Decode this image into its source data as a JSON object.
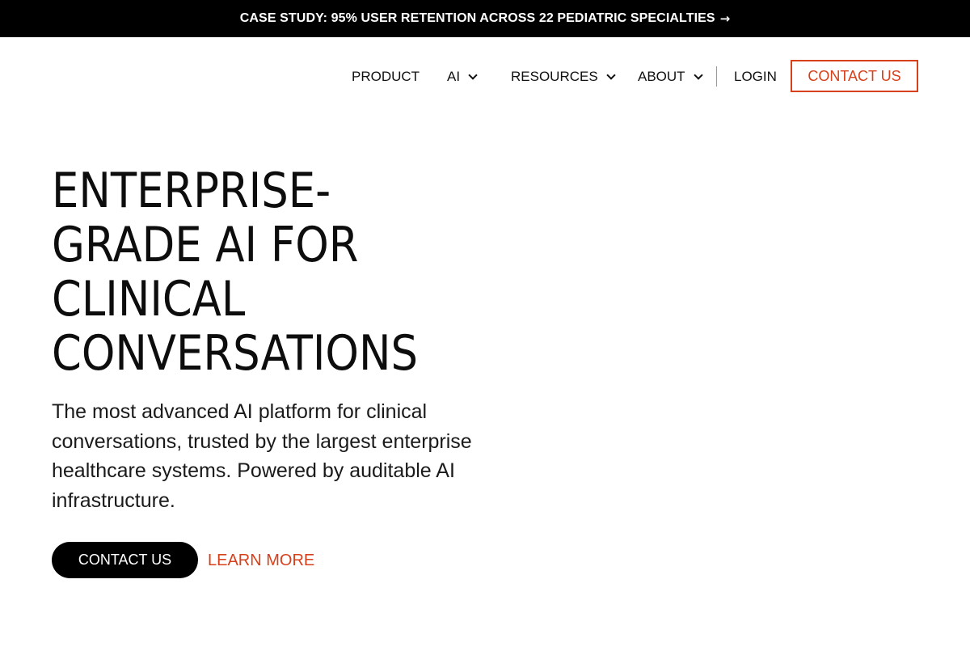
{
  "banner": {
    "text": "CASE STUDY: 95% USER RETENTION ACROSS 22 PEDIATRIC SPECIALTIES",
    "arrow": "→"
  },
  "nav": {
    "product": "PRODUCT",
    "ai": "AI",
    "resources": "RESOURCES",
    "about": "ABOUT",
    "login": "LOGIN",
    "contact": "CONTACT US"
  },
  "hero": {
    "title_lines": [
      "ENTERPRISE-",
      "GRADE AI FOR",
      "CLINICAL",
      "CONVERSATIONS"
    ],
    "subtitle": "The most advanced AI platform for clinical conversations, trusted by the largest enterprise healthcare systems. Powered by auditable AI infrastructure.",
    "cta_primary": "CONTACT US",
    "cta_secondary": "LEARN MORE"
  },
  "colors": {
    "accent": "#d6401a",
    "banner_bg": "#000000",
    "primary_button_bg": "#000000"
  }
}
